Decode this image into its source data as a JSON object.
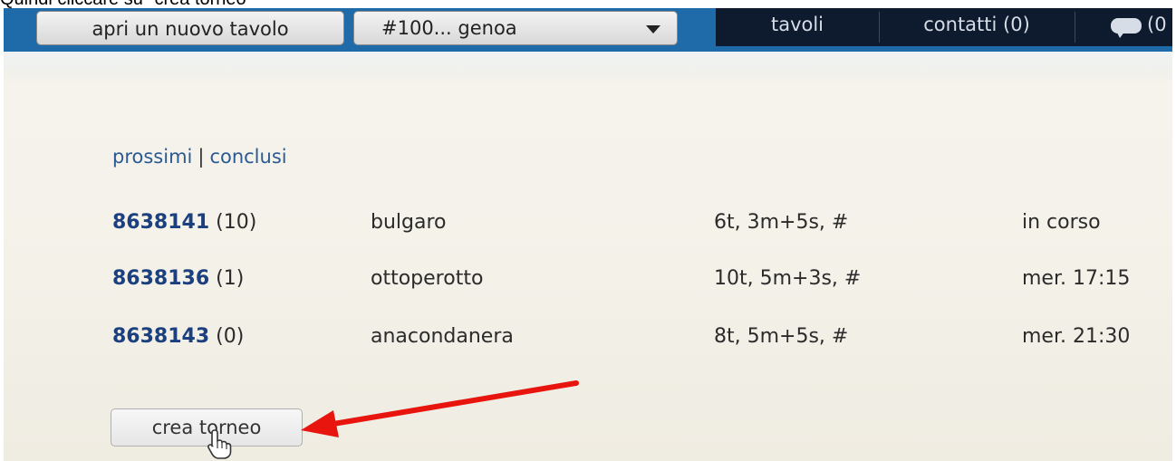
{
  "caption": "Quindi cliccare su \"crea torneo\"",
  "header": {
    "new_table_button": "apri un nuovo tavolo",
    "table_select_value": "#100... genoa",
    "nav": {
      "tavoli": "tavoli",
      "contatti": "contatti (0)",
      "chat_count": "(0"
    }
  },
  "filters": {
    "prossimi": "prossimi",
    "separator": "|",
    "conclusi": "conclusi"
  },
  "tournaments": [
    {
      "id": "8638141",
      "count": "(10)",
      "name": "bulgaro",
      "format": "6t, 3m+5s, #",
      "when": "in corso"
    },
    {
      "id": "8638136",
      "count": "(1)",
      "name": "ottoperotto",
      "format": "10t, 5m+3s, #",
      "when": "mer. 17:15"
    },
    {
      "id": "8638143",
      "count": "(0)",
      "name": "anacondanera",
      "format": "8t, 5m+5s, #",
      "when": "mer. 21:30"
    }
  ],
  "actions": {
    "crea_torneo": "crea torneo"
  },
  "colors": {
    "annotation_arrow": "#e8150f",
    "nav_background": "#0e1a2e",
    "link": "#2a5a93",
    "tournament_id": "#1c3f7d"
  },
  "icons": {
    "dropdown": "chevron-down-icon",
    "chat": "chat-bubble-icon",
    "cursor": "hand-pointer-icon"
  }
}
